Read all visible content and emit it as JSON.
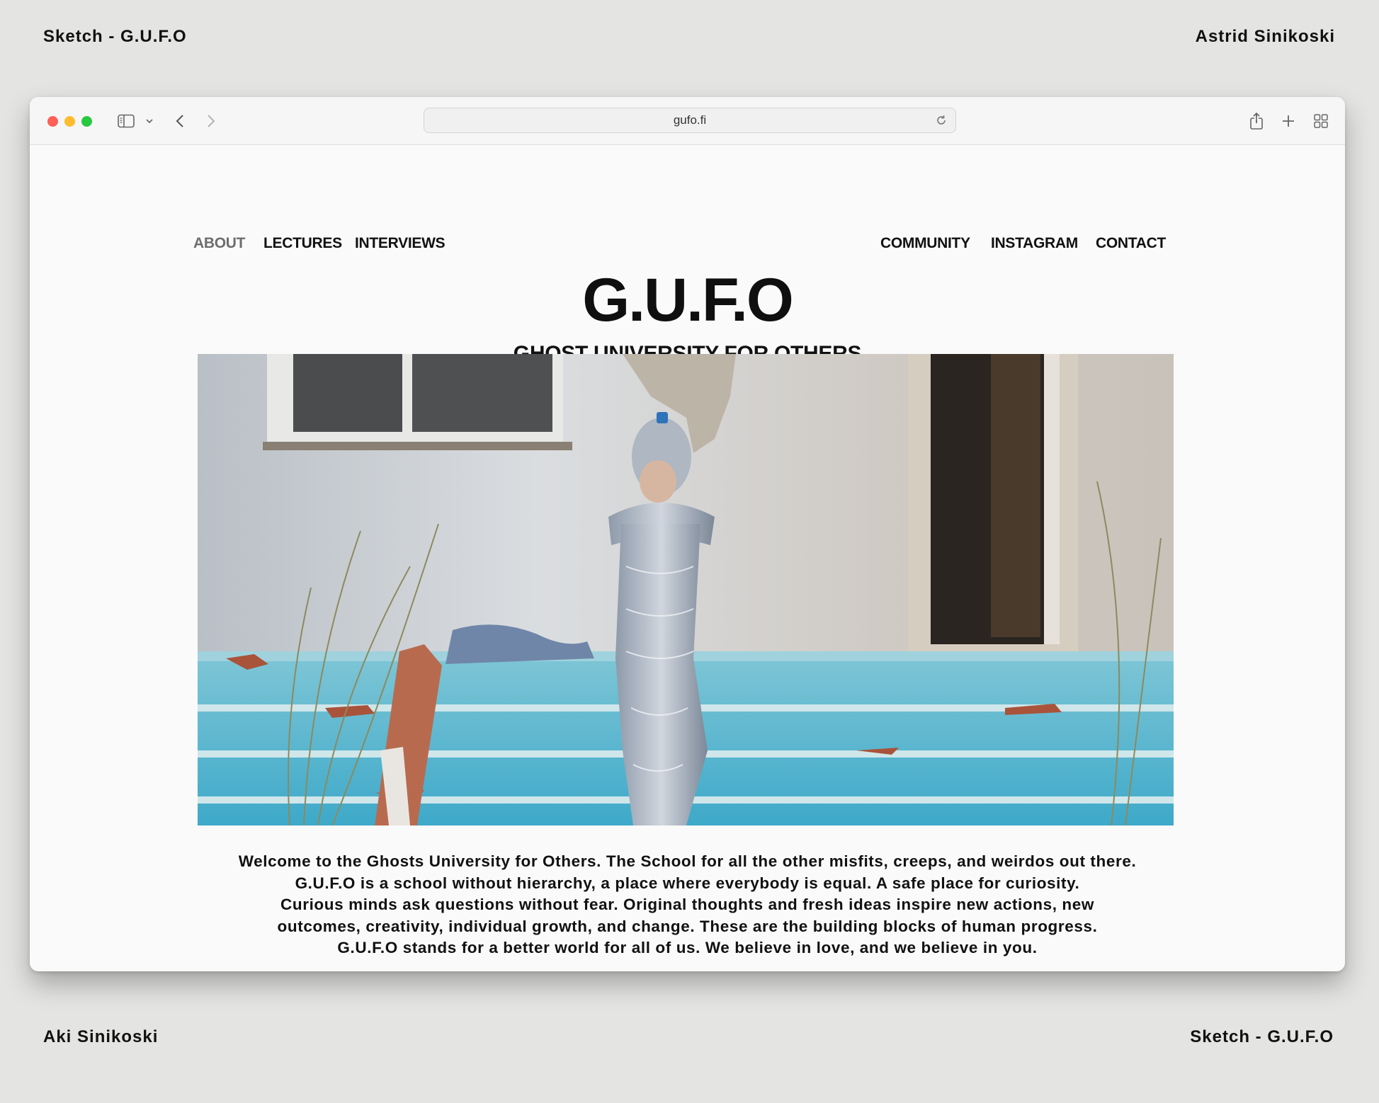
{
  "frame": {
    "top_left": "Sketch - G.U.F.O",
    "top_right": "Astrid Sinikoski",
    "bottom_left": "Aki Sinikoski",
    "bottom_right": "Sketch - G.U.F.O"
  },
  "browser": {
    "url": "gufo.fi",
    "icons": [
      "sidebar-icon",
      "chevron-down-icon",
      "back-icon",
      "forward-icon",
      "reload-icon",
      "share-icon",
      "new-tab-icon",
      "tab-overview-icon"
    ]
  },
  "site": {
    "nav_left": [
      "ABOUT",
      "LECTURES",
      "INTERVIEWS"
    ],
    "nav_right": [
      "COMMUNITY",
      "INSTAGRAM",
      "CONTACT"
    ],
    "active_nav": "ABOUT",
    "logo": "G.U.F.O",
    "subtitle": "GHOST UNIVERSITY FOR OTHERS",
    "intro_lines": [
      "Welcome to the Ghosts University for Others. The School for all the other misfits, creeps, and weirdos out there.",
      "G.U.F.O is a school without hierarchy, a place where everybody is equal. A safe place for curiosity.",
      "Curious minds ask questions without fear. Original thoughts and fresh ideas inspire new actions, new",
      "outcomes, creativity, individual growth, and change. These are the building blocks of human progress.",
      "G.U.F.O stands for a better world for all of us. We believe in love, and we believe in you."
    ]
  },
  "colors": {
    "page_bg": "#e4e4e2",
    "window_bg": "#fafafa",
    "toolbar_bg": "#f6f6f6",
    "active_nav": "#6d6d6d",
    "text": "#111111"
  }
}
